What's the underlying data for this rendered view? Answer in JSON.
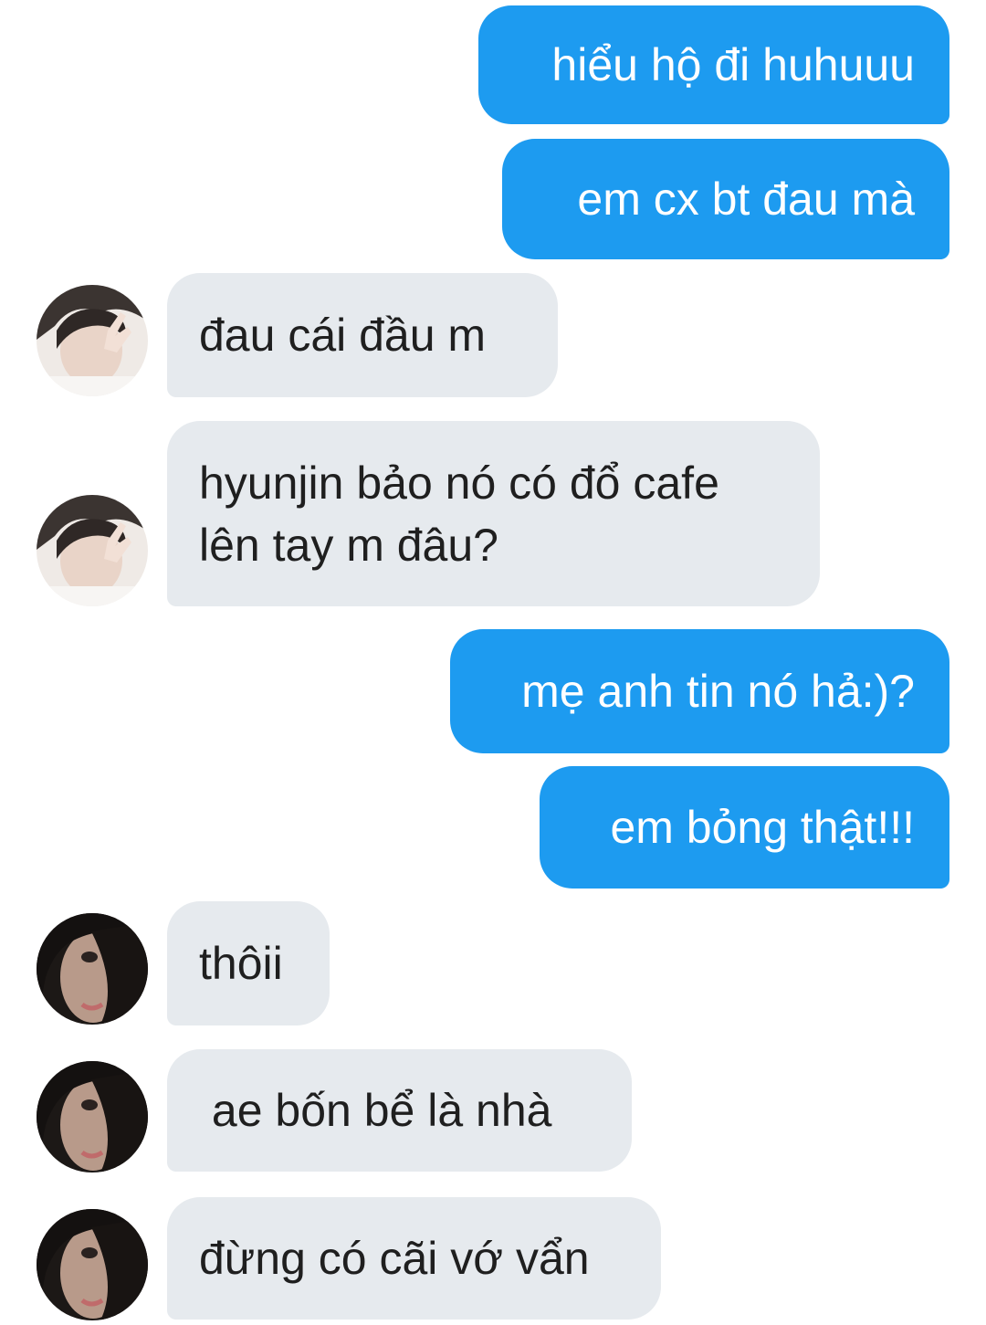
{
  "conversation": {
    "messages": [
      {
        "direction": "outgoing",
        "text": "hiểu hộ đi huhuuu"
      },
      {
        "direction": "outgoing",
        "text": "em cx bt đau mà"
      },
      {
        "direction": "incoming",
        "avatar": "light-photo-avatar",
        "text": "đau cái đầu m"
      },
      {
        "direction": "incoming",
        "avatar": "light-photo-avatar",
        "text": "hyunjin bảo nó có đổ cafe\nlên tay m đâu?"
      },
      {
        "direction": "outgoing",
        "text": "mẹ anh tin nó hả:)?"
      },
      {
        "direction": "outgoing",
        "text": "em bỏng thật!!!"
      },
      {
        "direction": "incoming",
        "avatar": "dark-photo-avatar",
        "text": "thôii"
      },
      {
        "direction": "incoming",
        "avatar": "dark-photo-avatar",
        "text": " ae bốn bể là nhà"
      },
      {
        "direction": "incoming",
        "avatar": "dark-photo-avatar",
        "text": "đừng có cãi vớ vẩn"
      }
    ]
  },
  "colors": {
    "outgoing_bubble": "#1d9bf0",
    "incoming_bubble": "#e6eaee",
    "outgoing_text": "#ffffff",
    "incoming_text": "#1f1f1f"
  }
}
